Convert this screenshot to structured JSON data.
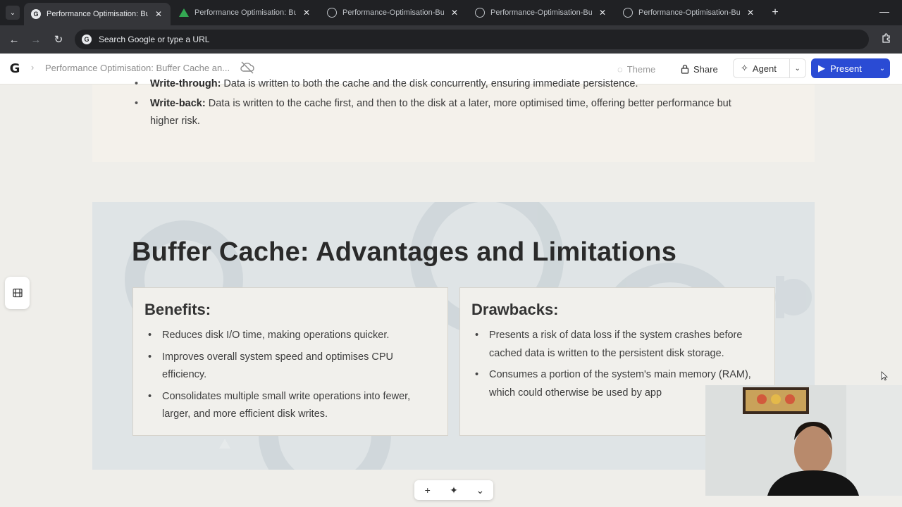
{
  "browser": {
    "tabs": [
      {
        "title": "Performance Optimisation: Buff",
        "favicon": "gamma-icon",
        "active": true
      },
      {
        "title": "Performance Optimisation: Buff",
        "favicon": "google-drive-icon",
        "active": false
      },
      {
        "title": "Performance-Optimisation-Buff",
        "favicon": "globe-icon",
        "active": false
      },
      {
        "title": "Performance-Optimisation-Buff",
        "favicon": "globe-icon",
        "active": false
      },
      {
        "title": "Performance-Optimisation-Buff",
        "favicon": "globe-icon",
        "active": false
      }
    ],
    "omnibox_placeholder": "Search Google or type a URL"
  },
  "app_header": {
    "doc_title": "Performance Optimisation: Buffer Cache an...",
    "theme_label": "Theme",
    "share_label": "Share",
    "agent_label": "Agent",
    "present_label": "Present"
  },
  "prev_card": {
    "cut_item": {
      "term": "Write-through:",
      "text": " Data is written to both the cache and the disk concurrently, ensuring immediate persistence."
    },
    "item": {
      "term": "Write-back:",
      "text": " Data is written to the cache first, and then to the disk at a later, more optimised time, offering better performance but higher risk."
    }
  },
  "slide": {
    "title": "Buffer Cache: Advantages and Limitations",
    "benefits": {
      "heading": "Benefits:",
      "items": [
        "Reduces disk I/O time, making operations quicker.",
        "Improves overall system speed and optimises CPU efficiency.",
        "Consolidates multiple small write operations into fewer, larger, and more efficient disk writes."
      ]
    },
    "drawbacks": {
      "heading": "Drawbacks:",
      "items": [
        "Presents a risk of data loss if the system crashes before cached data is written to the persistent disk storage.",
        "Consumes a portion of the system's main memory (RAM), which could otherwise be used by app"
      ]
    }
  },
  "bottom_toolbar": {
    "add": "+",
    "ai": "✦",
    "more": "⌄"
  },
  "colors": {
    "accent": "#2a4bd4",
    "chrome_dark": "#202124",
    "slide_bg": "#dfe4e6",
    "page_bg": "#efeeea"
  }
}
